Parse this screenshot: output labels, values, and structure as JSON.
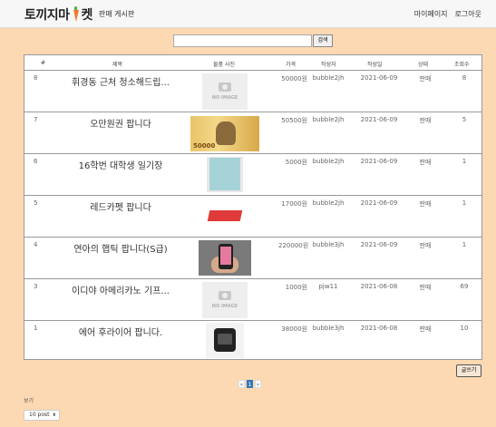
{
  "header": {
    "brand_left": "토끼지마",
    "brand_right": "켓",
    "brand_icon": "carrot-icon",
    "board_link": "판매 게시판",
    "mypage": "마이페이지",
    "logout": "로그아웃"
  },
  "search": {
    "placeholder": "",
    "button": "검색"
  },
  "table": {
    "columns": [
      "#",
      "제목",
      "물품 사진",
      "가격",
      "작성자",
      "작성일",
      "상태",
      "조회수"
    ],
    "rows": [
      {
        "num": "8",
        "title": "휘경동 근처 청소해드립...",
        "image": "no-image",
        "no_image_label": "NO IMAGE",
        "price": "50000원",
        "author": "bubble2jh",
        "date": "2021-06-09",
        "status": "판매",
        "views": "8"
      },
      {
        "num": "7",
        "title": "오만원권 팝니다",
        "image": "banknote",
        "money_label": "50000",
        "price": "50500원",
        "author": "bubble2jh",
        "date": "2021-06-09",
        "status": "판매",
        "views": "5"
      },
      {
        "num": "6",
        "title": "16학번 대학생 일기장",
        "image": "diary",
        "price": "5000원",
        "author": "bubble2jh",
        "date": "2021-06-09",
        "status": "판매",
        "views": "1"
      },
      {
        "num": "5",
        "title": "레드카펫 팝니다",
        "image": "red-carpet",
        "price": "17000원",
        "author": "bubble2jh",
        "date": "2021-06-09",
        "status": "판매",
        "views": "1"
      },
      {
        "num": "4",
        "title": "연아의 햅틱 팝니다(S급)",
        "image": "phone",
        "price": "220000원",
        "author": "bubble3jh",
        "date": "2021-06-09",
        "status": "판매",
        "views": "1"
      },
      {
        "num": "3",
        "title": "이디야 아메리카노 기프...",
        "image": "no-image",
        "no_image_label": "NO IMAGE",
        "price": "1000원",
        "author": "pjw11",
        "date": "2021-06-08",
        "status": "판매",
        "views": "69"
      },
      {
        "num": "1",
        "title": "에어 후라이어 팝니다.",
        "image": "air-fryer",
        "price": "38000원",
        "author": "bubble3jh",
        "date": "2021-06-08",
        "status": "판매",
        "views": "10"
      }
    ]
  },
  "write_button": "글쓰기",
  "pagination": {
    "prev": "«",
    "current": "1",
    "next": "»"
  },
  "show": {
    "label": "보기",
    "selected": "10 post",
    "chevron": "⬍"
  },
  "colors": {
    "page_bg": "#fcd9b2",
    "navbar_bg": "#f7f7f7",
    "active_page": "#337ab7"
  }
}
